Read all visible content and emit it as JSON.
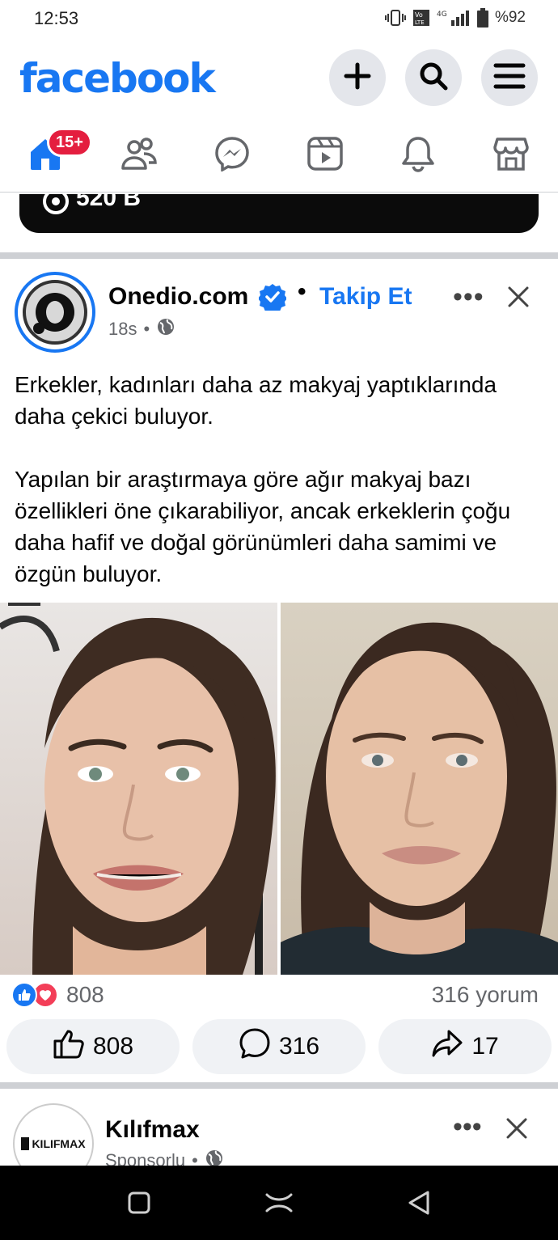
{
  "status_bar": {
    "time": "12:53",
    "battery": "%92",
    "network": "4G"
  },
  "header": {
    "logo": "facebook",
    "create_icon": "plus-icon",
    "search_icon": "search-icon",
    "menu_icon": "hamburger-menu-icon"
  },
  "nav": {
    "items": [
      "home",
      "friends",
      "messenger",
      "video",
      "notifications",
      "marketplace"
    ],
    "home_badge": "15+"
  },
  "previous_card": {
    "views": "520 B"
  },
  "post": {
    "page_name": "Onedio.com",
    "follow_label": "Takip Et",
    "separator": "•",
    "time": "18s",
    "meta_dot": "•",
    "more": "•••",
    "text_paragraph_1": "Erkekler, kadınları daha az makyaj yaptıklarında daha çekici buluyor.",
    "text_paragraph_2": "Yapılan bir araştırmaya göre ağır makyaj bazı özellikleri öne çıkarabiliyor, ancak erkeklerin çoğu daha hafif ve doğal görünümleri daha samimi ve özgün buluyor.",
    "reaction_count": "808",
    "comment_summary": "316 yorum",
    "like_count": "808",
    "comment_count": "316",
    "share_count": "17"
  },
  "sponsored": {
    "name": "Kılıfmax",
    "label": "Sponsorlu",
    "meta_dot": "•",
    "logo_text": "KILIFMAX",
    "more": "•••"
  },
  "colors": {
    "brand": "#1877f2",
    "badge": "#e41e3f",
    "love": "#f33e58",
    "button_bg": "#f0f2f5"
  }
}
